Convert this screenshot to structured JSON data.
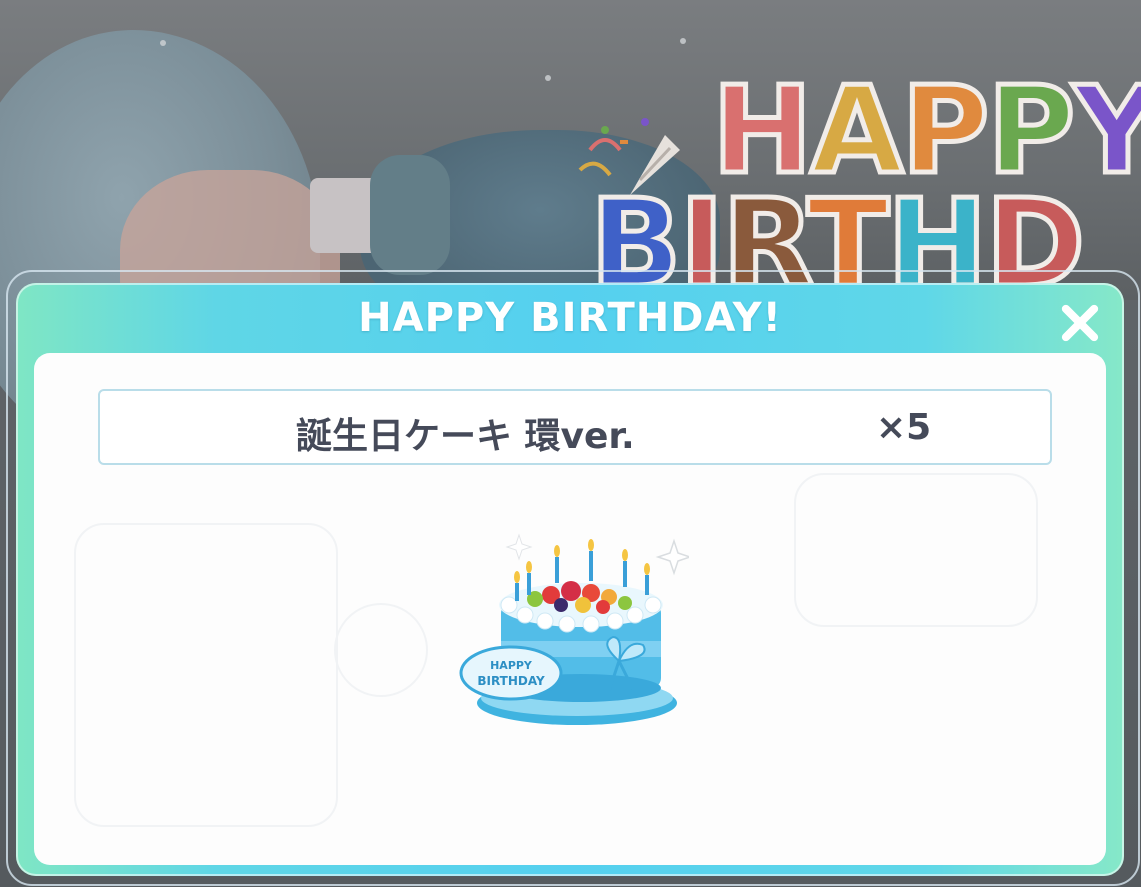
{
  "background": {
    "banner_row1": [
      {
        "char": "H",
        "color": "#d9706f"
      },
      {
        "char": "A",
        "color": "#d7a944"
      },
      {
        "char": "P",
        "color": "#e08a3e"
      },
      {
        "char": "P",
        "color": "#6aa84f"
      },
      {
        "char": "Y",
        "color": "#7a55c9"
      }
    ],
    "banner_row2": [
      {
        "char": "B",
        "color": "#3f61c8"
      },
      {
        "char": "I",
        "color": "#c75b5b"
      },
      {
        "char": "R",
        "color": "#8a5a3c"
      },
      {
        "char": "T",
        "color": "#e07b39"
      },
      {
        "char": "H",
        "color": "#3bb3c9"
      },
      {
        "char": "D",
        "color": "#c75b5b"
      }
    ]
  },
  "dialog": {
    "title": "HAPPY BIRTHDAY!",
    "close_icon": "close-icon",
    "accent_colors": [
      "#7fe6c4",
      "#55d0ef"
    ]
  },
  "reward": {
    "name": "誕生日ケーキ 環ver.",
    "quantity": "×5",
    "icon": "birthday-cake-icon",
    "plaque_line1": "HAPPY",
    "plaque_line2": "BIRTHDAY"
  }
}
